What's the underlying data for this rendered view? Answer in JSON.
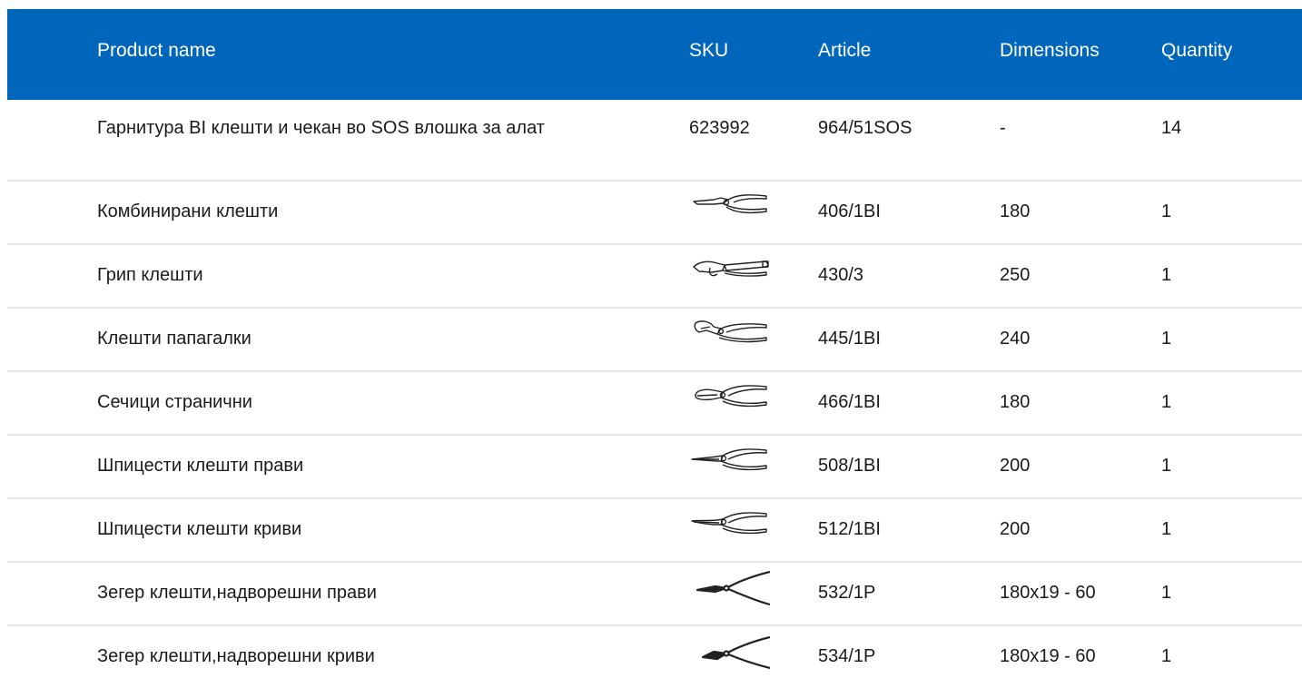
{
  "header": {
    "name": "Product name",
    "sku": "SKU",
    "article": "Article",
    "dimensions": "Dimensions",
    "quantity": "Quantity"
  },
  "colors": {
    "header_bg": "#0066bb",
    "header_text": "#ffffff",
    "row_divider": "#e6e6e6"
  },
  "rows": [
    {
      "name": "Гарнитура BI клешти и чекан во SOS влошка за алат",
      "sku": "623992",
      "article": "964/51SOS",
      "dimensions": "-",
      "quantity": "14"
    },
    {
      "name": "Комбинирани клешти",
      "sku_icon": "combination-pliers-icon",
      "article": "406/1BI",
      "dimensions": "180",
      "quantity": "1"
    },
    {
      "name": "Грип клешти",
      "sku_icon": "locking-pliers-icon",
      "article": "430/3",
      "dimensions": "250",
      "quantity": "1"
    },
    {
      "name": "Клешти папагалки",
      "sku_icon": "water-pump-pliers-icon",
      "article": "445/1BI",
      "dimensions": "240",
      "quantity": "1"
    },
    {
      "name": "Сечици странични",
      "sku_icon": "side-cutters-icon",
      "article": "466/1BI",
      "dimensions": "180",
      "quantity": "1"
    },
    {
      "name": "Шпицести клешти прави",
      "sku_icon": "needle-nose-pliers-icon",
      "article": "508/1BI",
      "dimensions": "200",
      "quantity": "1"
    },
    {
      "name": "Шпицести клешти криви",
      "sku_icon": "bent-nose-pliers-icon",
      "article": "512/1BI",
      "dimensions": "200",
      "quantity": "1"
    },
    {
      "name": "Зегер клешти,надворешни прави",
      "sku_icon": "circlip-pliers-straight-icon",
      "article": "532/1P",
      "dimensions": "180x19 - 60",
      "quantity": "1"
    },
    {
      "name": "Зегер клешти,надворешни криви",
      "sku_icon": "circlip-pliers-bent-icon",
      "article": "534/1P",
      "dimensions": "180x19 - 60",
      "quantity": "1"
    }
  ]
}
